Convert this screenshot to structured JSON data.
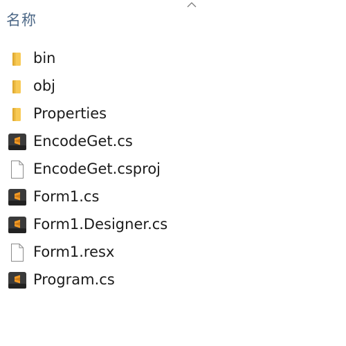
{
  "header": {
    "name_column": "名称",
    "sort_indicator_icon": "chevron-up-icon"
  },
  "files": [
    {
      "name": "bin",
      "icon": "folder-icon"
    },
    {
      "name": "obj",
      "icon": "folder-icon"
    },
    {
      "name": "Properties",
      "icon": "folder-icon"
    },
    {
      "name": "EncodeGet.cs",
      "icon": "sublime-cs-icon"
    },
    {
      "name": "EncodeGet.csproj",
      "icon": "blank-file-icon"
    },
    {
      "name": "Form1.cs",
      "icon": "sublime-cs-icon"
    },
    {
      "name": "Form1.Designer.cs",
      "icon": "sublime-cs-icon"
    },
    {
      "name": "Form1.resx",
      "icon": "blank-file-icon"
    },
    {
      "name": "Program.cs",
      "icon": "sublime-cs-icon"
    }
  ],
  "colors": {
    "header_text": "#4d6887",
    "file_text": "#1b1b1b",
    "folder": "#f8c954",
    "sublime_bg": "#3a3a3a",
    "sublime_accent": "#f29a25"
  }
}
